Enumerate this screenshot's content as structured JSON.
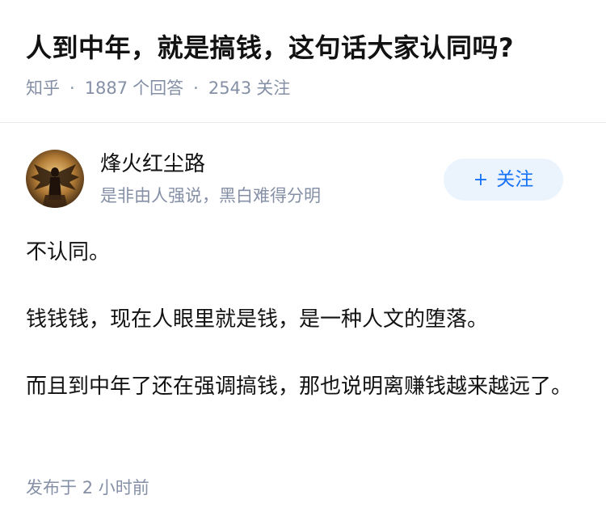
{
  "question": {
    "title": "人到中年，就是搞钱，这句话大家认同吗?",
    "source": "知乎",
    "separator": "·",
    "answers_count": "1887",
    "answers_label": "个回答",
    "followers_count": "2543",
    "followers_label": "关注"
  },
  "author": {
    "name": "烽火红尘路",
    "bio": "是非由人强说，黑白难得分明",
    "avatar_icon": "winged-figure-avatar",
    "follow_button": {
      "icon": "+",
      "label": "关注"
    }
  },
  "answer": {
    "paragraphs": [
      "不认同。",
      "钱钱钱，现在人眼里就是钱，是一种人文的堕落。",
      "而且到中年了还在强调搞钱，那也说明离赚钱越来越远了。"
    ]
  },
  "footer": {
    "posted_label": "发布于",
    "posted_time": "2 小时前"
  },
  "colors": {
    "title": "#121212",
    "meta": "#8590a6",
    "accent": "#1772f6",
    "follow_bg": "#ebf4fd",
    "divider": "#ebebeb"
  }
}
